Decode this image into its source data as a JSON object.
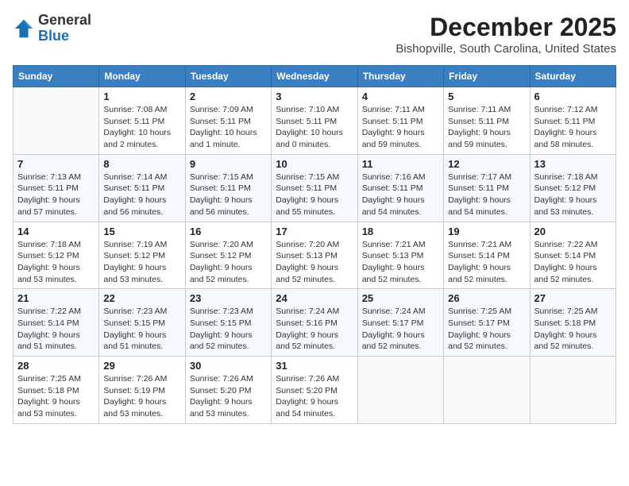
{
  "header": {
    "logo_general": "General",
    "logo_blue": "Blue",
    "month_title": "December 2025",
    "location": "Bishopville, South Carolina, United States"
  },
  "days_of_week": [
    "Sunday",
    "Monday",
    "Tuesday",
    "Wednesday",
    "Thursday",
    "Friday",
    "Saturday"
  ],
  "weeks": [
    [
      {
        "day": "",
        "info": ""
      },
      {
        "day": "1",
        "info": "Sunrise: 7:08 AM\nSunset: 5:11 PM\nDaylight: 10 hours\nand 2 minutes."
      },
      {
        "day": "2",
        "info": "Sunrise: 7:09 AM\nSunset: 5:11 PM\nDaylight: 10 hours\nand 1 minute."
      },
      {
        "day": "3",
        "info": "Sunrise: 7:10 AM\nSunset: 5:11 PM\nDaylight: 10 hours\nand 0 minutes."
      },
      {
        "day": "4",
        "info": "Sunrise: 7:11 AM\nSunset: 5:11 PM\nDaylight: 9 hours\nand 59 minutes."
      },
      {
        "day": "5",
        "info": "Sunrise: 7:11 AM\nSunset: 5:11 PM\nDaylight: 9 hours\nand 59 minutes."
      },
      {
        "day": "6",
        "info": "Sunrise: 7:12 AM\nSunset: 5:11 PM\nDaylight: 9 hours\nand 58 minutes."
      }
    ],
    [
      {
        "day": "7",
        "info": "Sunrise: 7:13 AM\nSunset: 5:11 PM\nDaylight: 9 hours\nand 57 minutes."
      },
      {
        "day": "8",
        "info": "Sunrise: 7:14 AM\nSunset: 5:11 PM\nDaylight: 9 hours\nand 56 minutes."
      },
      {
        "day": "9",
        "info": "Sunrise: 7:15 AM\nSunset: 5:11 PM\nDaylight: 9 hours\nand 56 minutes."
      },
      {
        "day": "10",
        "info": "Sunrise: 7:15 AM\nSunset: 5:11 PM\nDaylight: 9 hours\nand 55 minutes."
      },
      {
        "day": "11",
        "info": "Sunrise: 7:16 AM\nSunset: 5:11 PM\nDaylight: 9 hours\nand 54 minutes."
      },
      {
        "day": "12",
        "info": "Sunrise: 7:17 AM\nSunset: 5:11 PM\nDaylight: 9 hours\nand 54 minutes."
      },
      {
        "day": "13",
        "info": "Sunrise: 7:18 AM\nSunset: 5:12 PM\nDaylight: 9 hours\nand 53 minutes."
      }
    ],
    [
      {
        "day": "14",
        "info": "Sunrise: 7:18 AM\nSunset: 5:12 PM\nDaylight: 9 hours\nand 53 minutes."
      },
      {
        "day": "15",
        "info": "Sunrise: 7:19 AM\nSunset: 5:12 PM\nDaylight: 9 hours\nand 53 minutes."
      },
      {
        "day": "16",
        "info": "Sunrise: 7:20 AM\nSunset: 5:12 PM\nDaylight: 9 hours\nand 52 minutes."
      },
      {
        "day": "17",
        "info": "Sunrise: 7:20 AM\nSunset: 5:13 PM\nDaylight: 9 hours\nand 52 minutes."
      },
      {
        "day": "18",
        "info": "Sunrise: 7:21 AM\nSunset: 5:13 PM\nDaylight: 9 hours\nand 52 minutes."
      },
      {
        "day": "19",
        "info": "Sunrise: 7:21 AM\nSunset: 5:14 PM\nDaylight: 9 hours\nand 52 minutes."
      },
      {
        "day": "20",
        "info": "Sunrise: 7:22 AM\nSunset: 5:14 PM\nDaylight: 9 hours\nand 52 minutes."
      }
    ],
    [
      {
        "day": "21",
        "info": "Sunrise: 7:22 AM\nSunset: 5:14 PM\nDaylight: 9 hours\nand 51 minutes."
      },
      {
        "day": "22",
        "info": "Sunrise: 7:23 AM\nSunset: 5:15 PM\nDaylight: 9 hours\nand 51 minutes."
      },
      {
        "day": "23",
        "info": "Sunrise: 7:23 AM\nSunset: 5:15 PM\nDaylight: 9 hours\nand 52 minutes."
      },
      {
        "day": "24",
        "info": "Sunrise: 7:24 AM\nSunset: 5:16 PM\nDaylight: 9 hours\nand 52 minutes."
      },
      {
        "day": "25",
        "info": "Sunrise: 7:24 AM\nSunset: 5:17 PM\nDaylight: 9 hours\nand 52 minutes."
      },
      {
        "day": "26",
        "info": "Sunrise: 7:25 AM\nSunset: 5:17 PM\nDaylight: 9 hours\nand 52 minutes."
      },
      {
        "day": "27",
        "info": "Sunrise: 7:25 AM\nSunset: 5:18 PM\nDaylight: 9 hours\nand 52 minutes."
      }
    ],
    [
      {
        "day": "28",
        "info": "Sunrise: 7:25 AM\nSunset: 5:18 PM\nDaylight: 9 hours\nand 53 minutes."
      },
      {
        "day": "29",
        "info": "Sunrise: 7:26 AM\nSunset: 5:19 PM\nDaylight: 9 hours\nand 53 minutes."
      },
      {
        "day": "30",
        "info": "Sunrise: 7:26 AM\nSunset: 5:20 PM\nDaylight: 9 hours\nand 53 minutes."
      },
      {
        "day": "31",
        "info": "Sunrise: 7:26 AM\nSunset: 5:20 PM\nDaylight: 9 hours\nand 54 minutes."
      },
      {
        "day": "",
        "info": ""
      },
      {
        "day": "",
        "info": ""
      },
      {
        "day": "",
        "info": ""
      }
    ]
  ]
}
